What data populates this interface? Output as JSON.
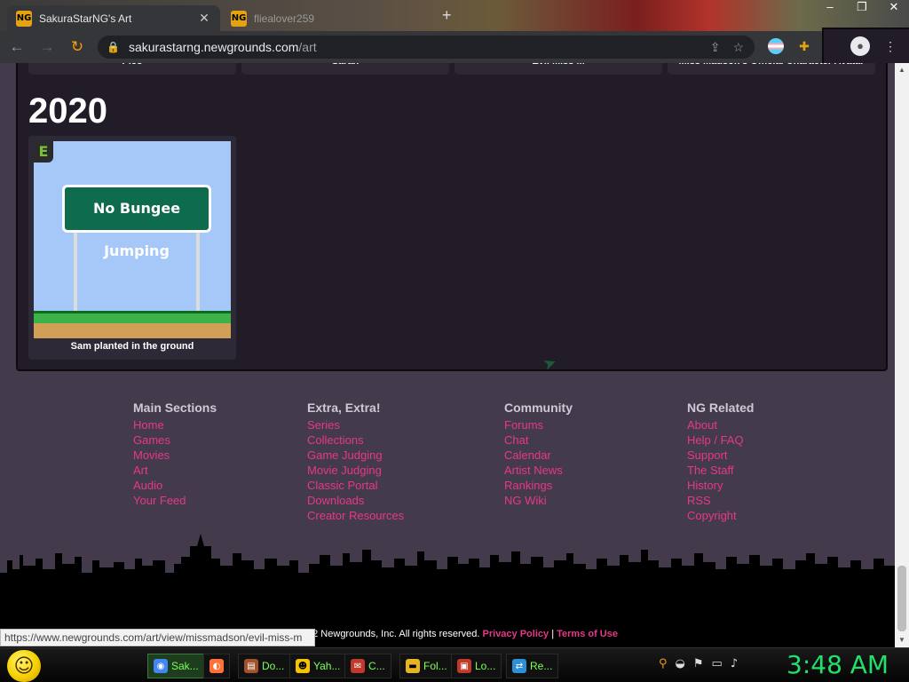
{
  "browser": {
    "tabs": [
      {
        "label": "SakuraStarNG's Art",
        "favicon": "NG"
      },
      {
        "label": "fliealover259",
        "favicon": "NG"
      }
    ],
    "new_tab": "+",
    "url_host": "sakurastarng.newgrounds.com",
    "url_path": "/art",
    "window_controls": [
      "–",
      "❐",
      "✕"
    ]
  },
  "page": {
    "previous_row": [
      "Pico",
      "Sarah",
      "Evil Miss M",
      "Miss Madson's Official Character Avatar"
    ],
    "year_heading": "2020",
    "art_card": {
      "rating": "E",
      "sign_text": "No Bungee Jumping",
      "caption": "Sam planted in the ground"
    },
    "footer": {
      "columns": [
        {
          "title": "Main Sections",
          "links": [
            "Home",
            "Games",
            "Movies",
            "Art",
            "Audio",
            "Your Feed"
          ]
        },
        {
          "title": "Extra, Extra!",
          "links": [
            "Series",
            "Collections",
            "Game Judging",
            "Movie Judging",
            "Classic Portal",
            "Downloads",
            "Creator Resources"
          ]
        },
        {
          "title": "Community",
          "links": [
            "Forums",
            "Chat",
            "Calendar",
            "Artist News",
            "Rankings",
            "NG Wiki"
          ]
        },
        {
          "title": "NG Related",
          "links": [
            "About",
            "Help / FAQ",
            "Support",
            "The Staff",
            "History",
            "RSS",
            "Copyright"
          ]
        }
      ],
      "copyright": "5-2022 Newgrounds, Inc. All rights reserved.",
      "privacy": "Privacy Policy",
      "separator": "|",
      "terms": "Terms of Use"
    },
    "status_url": "https://www.newgrounds.com/art/view/missmadson/evil-miss-m"
  },
  "taskbar": {
    "items": [
      {
        "label": "Sak...",
        "icon": "chrome-icon",
        "color": "#4285f4",
        "active": true
      },
      {
        "label": "",
        "icon": "firefox-icon",
        "color": "#ff7139",
        "active": false
      },
      {
        "label": "Do...",
        "icon": "document-icon",
        "color": "#a0522d",
        "active": false
      },
      {
        "label": "Yah...",
        "icon": "messenger-icon",
        "color": "#f5c400",
        "active": false
      },
      {
        "label": "C...",
        "icon": "mail-icon",
        "color": "#c0392b",
        "active": false
      },
      {
        "label": "Fol...",
        "icon": "folder-icon",
        "color": "#e6b422",
        "active": false
      },
      {
        "label": "Lo...",
        "icon": "window-icon",
        "color": "#c0392b",
        "active": false
      },
      {
        "label": "Re...",
        "icon": "network-icon",
        "color": "#2d8fd5",
        "active": false
      }
    ],
    "clock": "3:48 AM"
  }
}
